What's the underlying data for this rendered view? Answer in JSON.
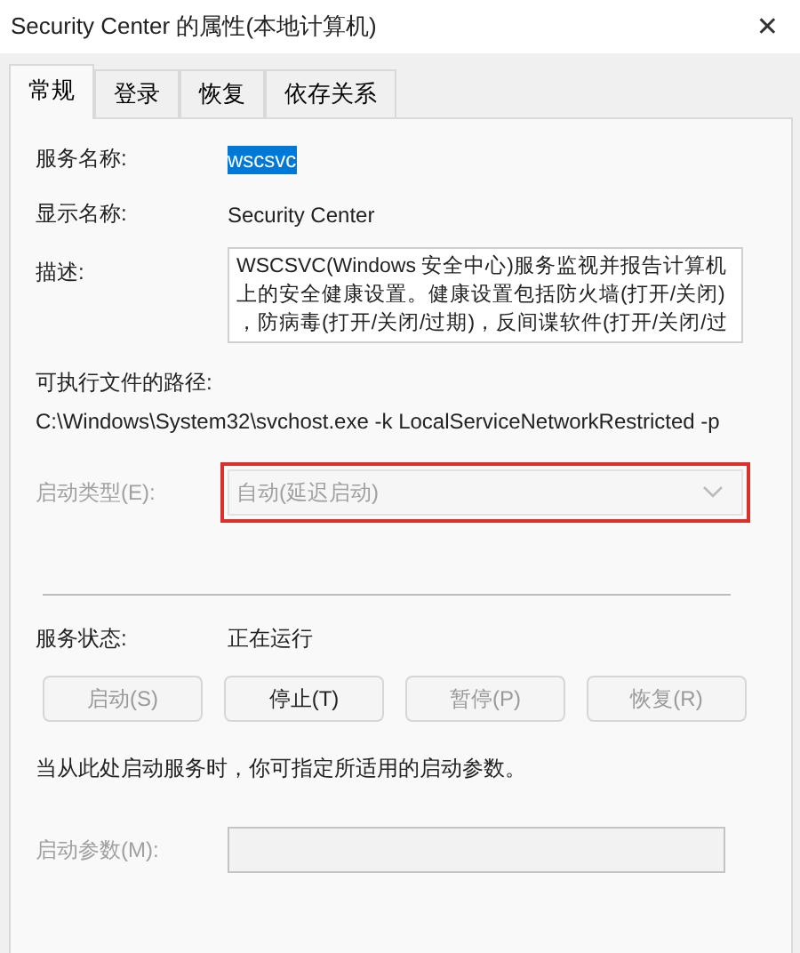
{
  "window": {
    "title": "Security Center 的属性(本地计算机)",
    "close": "✕"
  },
  "tabs": [
    {
      "label": "常规",
      "selected": true
    },
    {
      "label": "登录",
      "selected": false
    },
    {
      "label": "恢复",
      "selected": false
    },
    {
      "label": "依存关系",
      "selected": false
    }
  ],
  "service_name": {
    "label": "服务名称:",
    "value": "wscsvc",
    "selected": true
  },
  "display_name": {
    "label": "显示名称:",
    "value": "Security Center"
  },
  "description": {
    "label": "描述:",
    "lines": [
      "WSCSVC(Windows 安全中心)服务监视并报告计算机",
      "上的安全健康设置。健康设置包括防火墙(打开/关闭)",
      "，防病毒(打开/关闭/过期)，反间谍软件(打开/关闭/过"
    ]
  },
  "executable_path": {
    "label": "可执行文件的路径:",
    "value": "C:\\Windows\\System32\\svchost.exe -k LocalServiceNetworkRestricted -p"
  },
  "startup_type": {
    "label": "启动类型(E):",
    "value": "自动(延迟启动)",
    "disabled": true,
    "highlighted": true
  },
  "service_status": {
    "label": "服务状态:",
    "value": "正在运行"
  },
  "buttons": [
    {
      "label": "启动(S)",
      "disabled": true
    },
    {
      "label": "停止(T)",
      "disabled": false
    },
    {
      "label": "暂停(P)",
      "disabled": true
    },
    {
      "label": "恢复(R)",
      "disabled": true
    }
  ],
  "hint": "当从此处启动服务时，你可指定所适用的启动参数。",
  "start_parameters": {
    "label": "启动参数(M):",
    "disabled": true
  }
}
